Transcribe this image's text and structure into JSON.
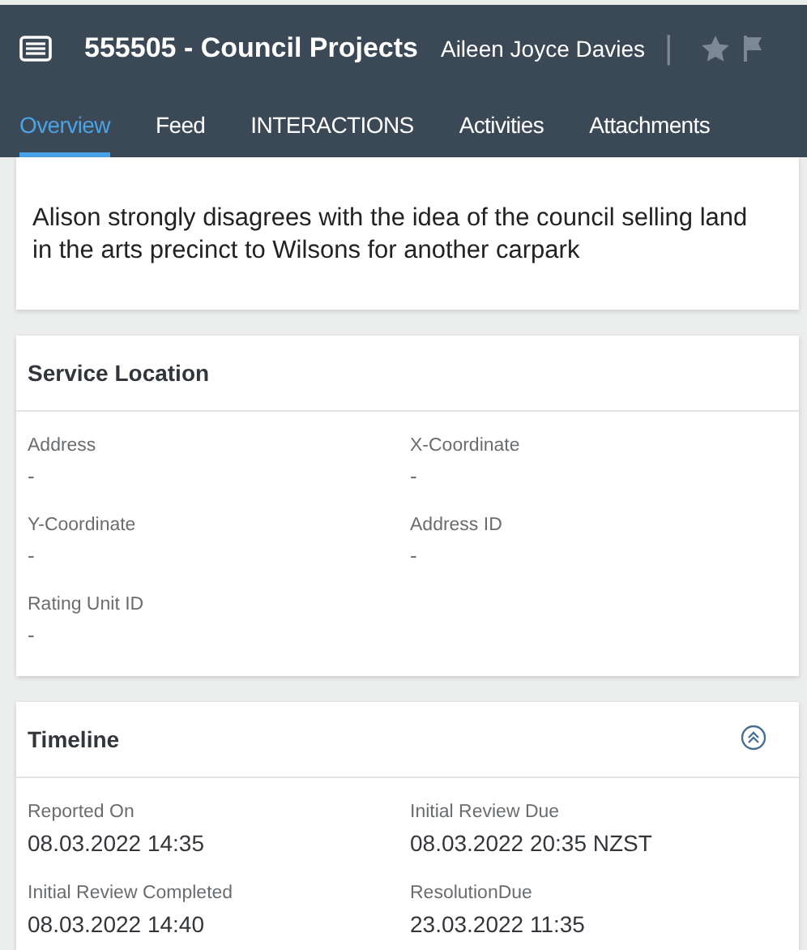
{
  "header": {
    "title": "555505 - Council Projects",
    "owner": "Aileen Joyce Davies",
    "separator": "|"
  },
  "tabs": [
    {
      "label": "Overview",
      "selected": true
    },
    {
      "label": "Feed",
      "selected": false
    },
    {
      "label": "INTERACTIONS",
      "selected": false
    },
    {
      "label": "Activities",
      "selected": false
    },
    {
      "label": "Attachments",
      "selected": false
    }
  ],
  "description": "Alison strongly disagrees with the idea of the council selling land in the arts precinct to Wilsons for another carpark",
  "service_location": {
    "title": "Service Location",
    "fields": [
      {
        "label": "Address",
        "value": "-"
      },
      {
        "label": "X-Coordinate",
        "value": "-"
      },
      {
        "label": "Y-Coordinate",
        "value": "-"
      },
      {
        "label": "Address ID",
        "value": "-"
      },
      {
        "label": "Rating Unit ID",
        "value": "-"
      }
    ]
  },
  "timeline": {
    "title": "Timeline",
    "expanded": true,
    "fields": [
      {
        "label": "Reported On",
        "value": "08.03.2022 14:35"
      },
      {
        "label": "Initial Review Due",
        "value": "08.03.2022 20:35 NZST"
      },
      {
        "label": "Initial Review Completed",
        "value": "08.03.2022 14:40"
      },
      {
        "label": "ResolutionDue",
        "value": "23.03.2022 11:35"
      }
    ]
  }
}
